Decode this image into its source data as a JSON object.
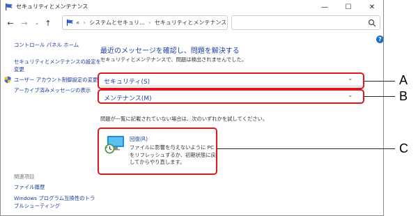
{
  "window": {
    "title": "セキュリティとメンテナンス",
    "controls": {
      "minimize": "—",
      "maximize": "☐",
      "close": "✕"
    }
  },
  "navigation": {
    "back": "←",
    "forward": "→",
    "recent": "⌄",
    "up": "↑",
    "breadcrumb_overflow": "«",
    "breadcrumbs": [
      "システムとセキュリ...",
      "セキュリティとメンテナンス"
    ],
    "separator": "›",
    "dropdown": "⌄",
    "refresh": "↻"
  },
  "help_button": "?",
  "sidebar": {
    "links": [
      {
        "label": "コントロール パネル ホーム"
      },
      {
        "label": "セキュリティとメンテナンスの設定を"
      },
      {
        "label": "変更"
      },
      {
        "label": "ユーザー アカウント制御設定の変更"
      },
      {
        "label": "アーカイブ済みメッセージの表示"
      }
    ],
    "related_heading": "関連項目",
    "related_links": [
      {
        "label": "ファイル履歴"
      },
      {
        "label": "Windows プログラム互換性のトラ"
      },
      {
        "label": "ブルシューティング"
      }
    ]
  },
  "main": {
    "title": "最近のメッセージを確認し、問題を解決する",
    "subtitle": "セキュリティとメンテナンスで、問題は検出されませんでした。",
    "sections": [
      {
        "label": "セキュリティ(S)",
        "chevron": "⌄"
      },
      {
        "label": "メンテナンス(M)",
        "chevron": "⌄"
      }
    ],
    "hint": "問題が一覧に記載されていない場合は、次のいずれかを試してください。",
    "recovery": {
      "title": "回復(R)",
      "description": "ファイルに影響を与えないように PC をリフレッシュするか、初期状態に戻してからやり直します。"
    }
  },
  "callouts": {
    "a": "A",
    "b": "B",
    "c": "C"
  },
  "colors": {
    "link": "#1a3b9a",
    "heading": "#1f3fa5",
    "highlight": "#e0161f",
    "help": "#1f6fd1"
  }
}
